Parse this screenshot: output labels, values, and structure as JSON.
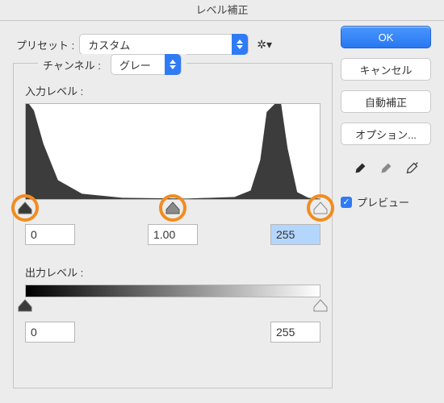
{
  "title": "レベル補正",
  "preset": {
    "label": "プリセット :",
    "value": "カスタム"
  },
  "channel": {
    "label": "チャンネル :",
    "value": "グレー"
  },
  "input_levels": {
    "label": "入力レベル :",
    "shadow": "0",
    "gamma": "1.00",
    "highlight": "255"
  },
  "output_levels": {
    "label": "出力レベル :",
    "shadow": "0",
    "highlight": "255"
  },
  "buttons": {
    "ok": "OK",
    "cancel": "キャンセル",
    "auto": "自動補正",
    "options": "オプション..."
  },
  "preview_label": "プレビュー",
  "preview_checked": true,
  "colors": {
    "accent": "#2f7bf6",
    "annotation_ring": "#f28c1f"
  }
}
